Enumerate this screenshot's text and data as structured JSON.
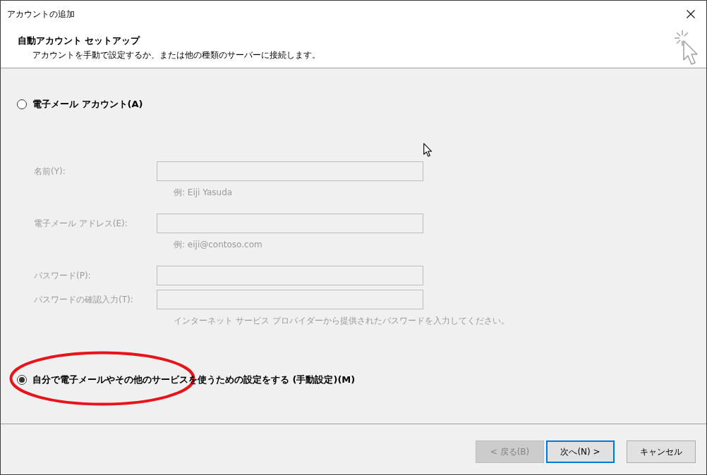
{
  "window": {
    "title": "アカウントの追加"
  },
  "header": {
    "title": "自動アカウント セットアップ",
    "subtitle": "アカウントを手動で設定するか、または他の種類のサーバーに接続します。"
  },
  "options": [
    {
      "label": "電子メール アカウント(A)",
      "selected": false,
      "highlighted": false,
      "fields": [
        {
          "label": "名前(Y):",
          "disabled": true,
          "hint": "例: Eiji Yasuda"
        },
        {
          "label": "電子メール アドレス(E):",
          "disabled": true,
          "hint": "例: eiji@contoso.com"
        },
        {
          "label": "パスワード(P):",
          "disabled": true
        },
        {
          "label": "パスワードの確認入力(T):",
          "disabled": true,
          "hint": "インターネット サービス プロバイダーから提供されたパスワードを入力してください。"
        }
      ]
    },
    {
      "label": "自分で電子メールやその他のサービスを使うための設定をする (手動設定)(M)",
      "selected": true,
      "highlighted": true
    }
  ],
  "buttons": [
    {
      "label": "< 戻る(B)",
      "disabled": true,
      "focused": false
    },
    {
      "label": "次へ(N) >",
      "disabled": false,
      "focused": true
    },
    {
      "label": "キャンセル",
      "disabled": false,
      "focused": false
    }
  ]
}
